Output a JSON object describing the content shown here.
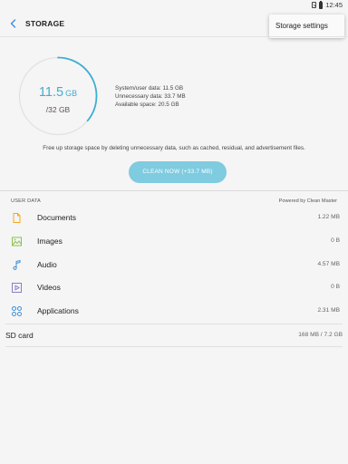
{
  "status_bar": {
    "time": "12:45"
  },
  "header": {
    "title": "STORAGE"
  },
  "menu": {
    "storage_settings_label": "Storage settings"
  },
  "storage": {
    "used_number": "11.5",
    "used_unit": "GB",
    "total": "/32 GB",
    "used_fraction": 0.36,
    "details": [
      "System/user data: 11.5 GB",
      "Unnecessary data: 33.7 MB",
      "Available space: 20.5 GB"
    ],
    "hint": "Free up storage space by deleting unnecessary data, such as cached, residual, and advertisement files.",
    "clean_button_label": "CLEAN NOW (+33.7 MB)"
  },
  "user_data": {
    "header": "USER DATA",
    "powered_by": "Powered by Clean Master",
    "items": [
      {
        "label": "Documents",
        "size": "1.22 MB",
        "icon": "document-icon"
      },
      {
        "label": "Images",
        "size": "0 B",
        "icon": "image-icon"
      },
      {
        "label": "Audio",
        "size": "4.57 MB",
        "icon": "music-note-icon"
      },
      {
        "label": "Videos",
        "size": "0 B",
        "icon": "video-icon"
      },
      {
        "label": "Applications",
        "size": "2.31 MB",
        "icon": "apps-icon"
      }
    ]
  },
  "sd_card": {
    "label": "SD card",
    "size": "168 MB / 7.2 GB"
  },
  "colors": {
    "accent": "#3faed2",
    "button": "#7fcbe0",
    "documents_icon": "#f5a623",
    "images_icon": "#8bc34a",
    "audio_icon": "#3d8fd6",
    "videos_icon": "#8e7cc3",
    "apps_icon": "#3d8fd6"
  }
}
